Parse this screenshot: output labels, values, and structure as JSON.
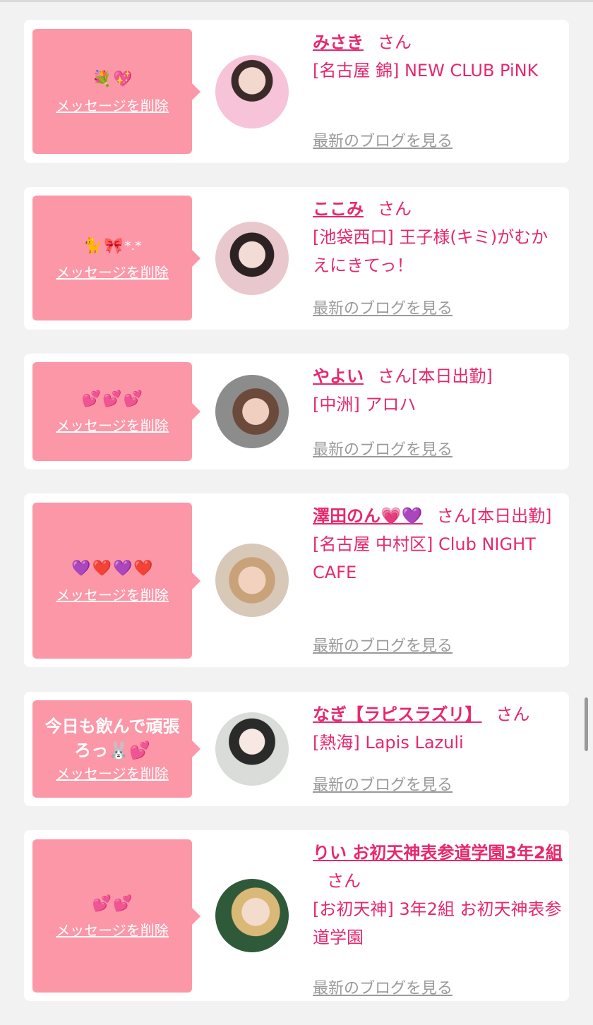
{
  "messages": [
    {
      "bubble_text": "",
      "emoji": "💐💖",
      "delete_label": "メッセージを削除",
      "name": "みさき",
      "honorific": "さん",
      "status": "",
      "shop": "[名古屋 錦] NEW CLUB PiNK",
      "blog_link": "最新のブログを見る"
    },
    {
      "bubble_text": "",
      "emoji": "🐈🎀*.*",
      "delete_label": "メッセージを削除",
      "name": "ここみ",
      "honorific": "さん",
      "status": "",
      "shop": "[池袋西口] 王子様(キミ)がむかえにきてっ！",
      "blog_link": "最新のブログを見る"
    },
    {
      "bubble_text": "",
      "emoji": "💕💕💕",
      "delete_label": "メッセージを削除",
      "name": "やよい",
      "honorific": "さん",
      "status": "[本日出勤]",
      "shop": "[中洲] アロハ",
      "blog_link": "最新のブログを見る"
    },
    {
      "bubble_text": "",
      "emoji": "💜❤️💜❤️",
      "delete_label": "メッセージを削除",
      "name": "澤田のん💗💜",
      "honorific": "さん",
      "status": "[本日出勤]",
      "shop": "[名古屋 中村区] Club NIGHT CAFE",
      "blog_link": "最新のブログを見る"
    },
    {
      "bubble_text": "今日も飲んで頑張ろっ🐰💕",
      "emoji": "",
      "delete_label": "メッセージを削除",
      "name": "なぎ【ラピスラズリ】",
      "honorific": "さん",
      "status": "",
      "shop": "[熱海] Lapis Lazuli",
      "blog_link": "最新のブログを見る"
    },
    {
      "bubble_text": "",
      "emoji": "💕💕",
      "delete_label": "メッセージを削除",
      "name": "りい お初天神表参道学園3年2組",
      "honorific": "さん",
      "status": "",
      "shop": "[お初天神] 3年2組 お初天神表参道学園",
      "blog_link": "最新のブログを見る"
    }
  ],
  "colors": {
    "accent": "#e6286e",
    "bubble": "#fc97a8",
    "background": "#f2f2f2",
    "link_gray": "#9a9a9a"
  }
}
